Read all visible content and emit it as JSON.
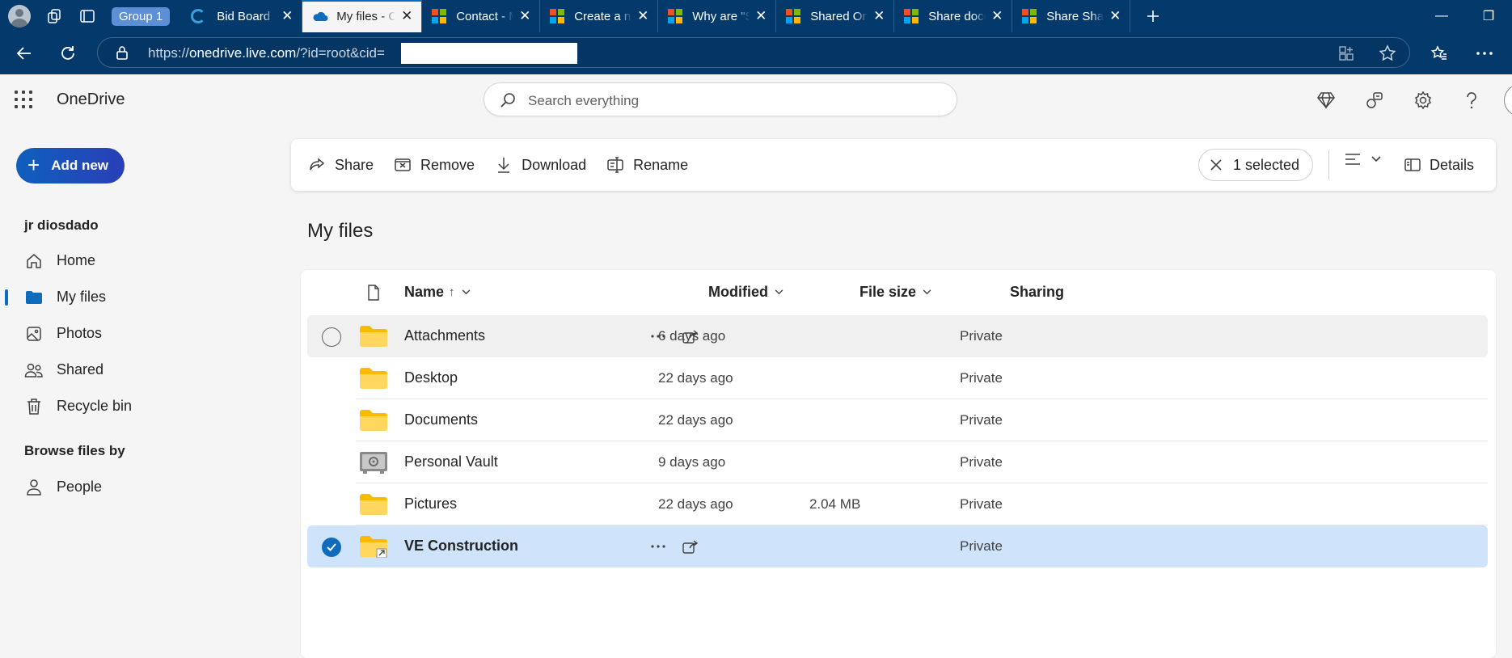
{
  "browser": {
    "group_label": "Group 1",
    "tabs": [
      {
        "label": "Bid Board",
        "icon": "bidboard-icon"
      },
      {
        "label": "My files - OneDrive",
        "icon": "onedrive-icon",
        "active": true
      },
      {
        "label": "Contact - Microsoft",
        "icon": "microsoft-icon"
      },
      {
        "label": "Create a new q",
        "icon": "microsoft-icon"
      },
      {
        "label": "Why are \"Shared\"",
        "icon": "microsoft-icon"
      },
      {
        "label": "Shared OneDrive",
        "icon": "microsoft-icon"
      },
      {
        "label": "Share documents",
        "icon": "microsoft-icon"
      },
      {
        "label": "Share SharePoint",
        "icon": "microsoft-icon"
      }
    ],
    "url_prefix": "https://",
    "url_host": "onedrive.live.com",
    "url_rest": "/?id=root&cid="
  },
  "app": {
    "brand": "OneDrive",
    "search_placeholder": "Search everything",
    "add_new": "Add new",
    "user_name": "jr diosdado",
    "nav": [
      {
        "label": "Home",
        "icon": "home-icon"
      },
      {
        "label": "My files",
        "icon": "folder-icon",
        "active": true
      },
      {
        "label": "Photos",
        "icon": "photos-icon"
      },
      {
        "label": "Shared",
        "icon": "people-icon"
      },
      {
        "label": "Recycle bin",
        "icon": "trash-icon"
      }
    ],
    "browse_title": "Browse files by",
    "browse_items": [
      {
        "label": "People",
        "icon": "person-icon"
      }
    ]
  },
  "commands": {
    "share": "Share",
    "remove": "Remove",
    "download": "Download",
    "rename": "Rename",
    "selected": "1 selected",
    "details": "Details"
  },
  "page_title": "My files",
  "columns": {
    "name": "Name",
    "sort_arrow": "↑",
    "modified": "Modified",
    "size": "File size",
    "sharing": "Sharing"
  },
  "files": [
    {
      "name": "Attachments",
      "modified": "6 days ago",
      "size": "",
      "sharing": "Private",
      "type": "folder",
      "state": "hover"
    },
    {
      "name": "Desktop",
      "modified": "22 days ago",
      "size": "",
      "sharing": "Private",
      "type": "folder"
    },
    {
      "name": "Documents",
      "modified": "22 days ago",
      "size": "",
      "sharing": "Private",
      "type": "folder"
    },
    {
      "name": "Personal Vault",
      "modified": "9 days ago",
      "size": "",
      "sharing": "Private",
      "type": "vault"
    },
    {
      "name": "Pictures",
      "modified": "22 days ago",
      "size": "2.04 MB",
      "sharing": "Private",
      "type": "folder"
    },
    {
      "name": "VE Construction",
      "modified": "",
      "size": "",
      "sharing": "Private",
      "type": "shared-folder",
      "state": "selected"
    }
  ],
  "colors": {
    "chrome_bg": "#043a6b",
    "accent": "#0f6cbd",
    "selected_row": "#cfe4fa",
    "folder": "#ffc83d"
  }
}
